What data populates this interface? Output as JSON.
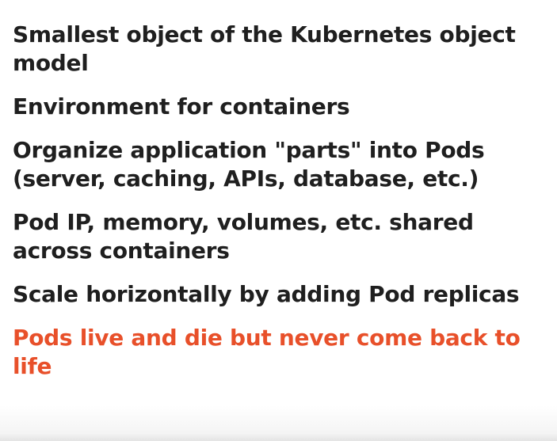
{
  "slide": {
    "bullets": [
      {
        "text": "Smallest object of the Kubernetes object model",
        "highlight": false
      },
      {
        "text": "Environment for containers",
        "highlight": false
      },
      {
        "text": "Organize application \"parts\" into Pods (server, caching, APIs, database, etc.)",
        "highlight": false
      },
      {
        "text": "Pod IP, memory, volumes, etc. shared across containers",
        "highlight": false
      },
      {
        "text": "Scale horizontally by adding Pod replicas",
        "highlight": false
      },
      {
        "text": "Pods live and die but never come back to life",
        "highlight": true
      }
    ],
    "colors": {
      "text": "#1f1f1f",
      "highlight": "#e8502a",
      "background": "#ffffff"
    }
  }
}
